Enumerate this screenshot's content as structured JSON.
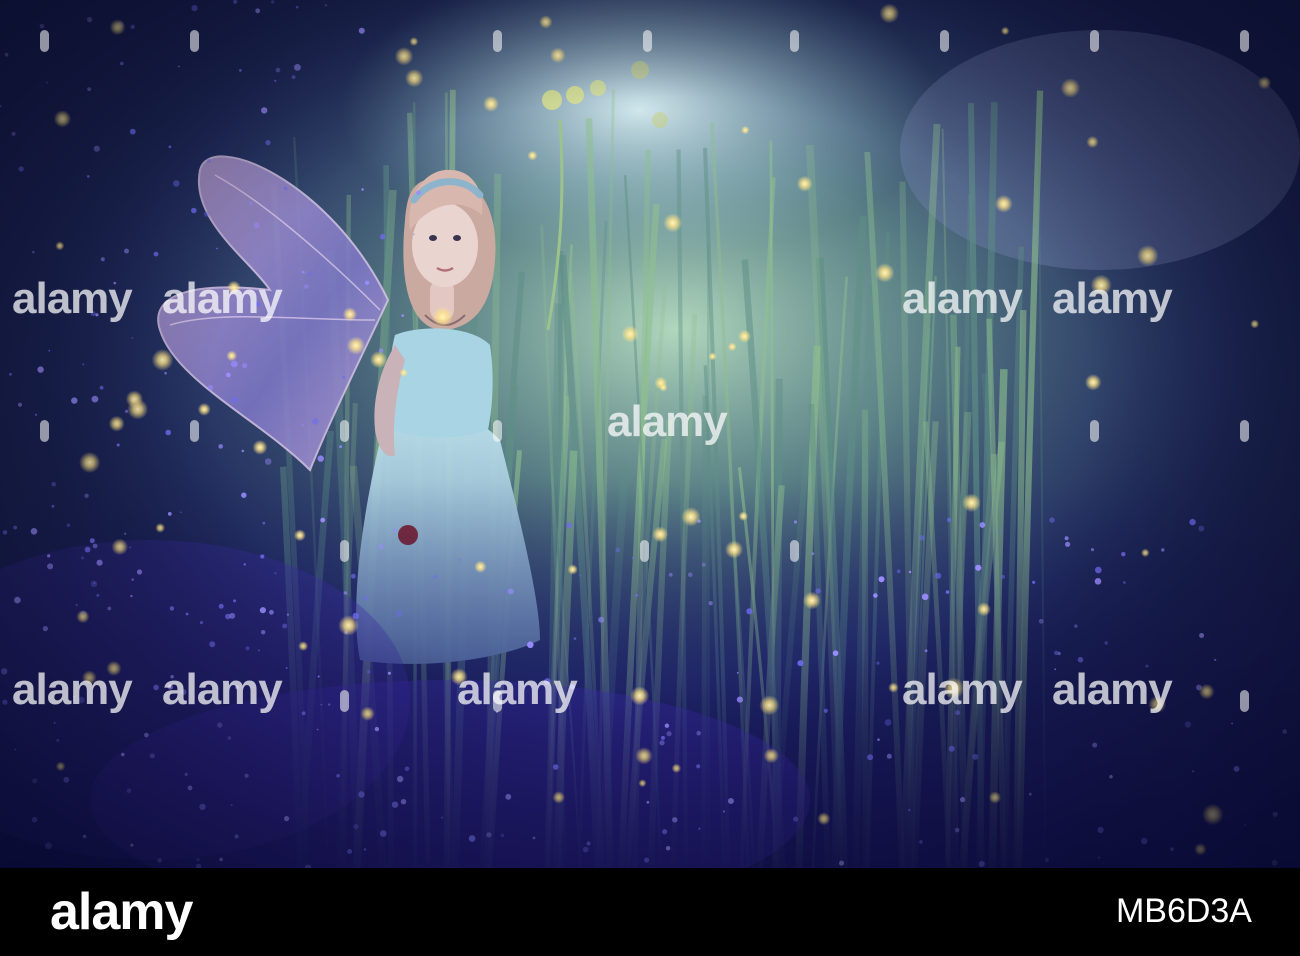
{
  "photo": {
    "subject": "fairy-figurine-in-night-grass-with-fireflies",
    "colors": {
      "deep_night": "#141a4a",
      "grass_glow": "#9fcf9a",
      "sky_glow": "#c9e3ee",
      "firefly": "#ffe48a",
      "sparkle": "#8a7dff",
      "dress": "#a9d4e4",
      "wings": "#9f8fd8"
    }
  },
  "watermarks": {
    "text": "alamy"
  },
  "footer": {
    "logo": "alamy",
    "image_id": "MB6D3A"
  }
}
